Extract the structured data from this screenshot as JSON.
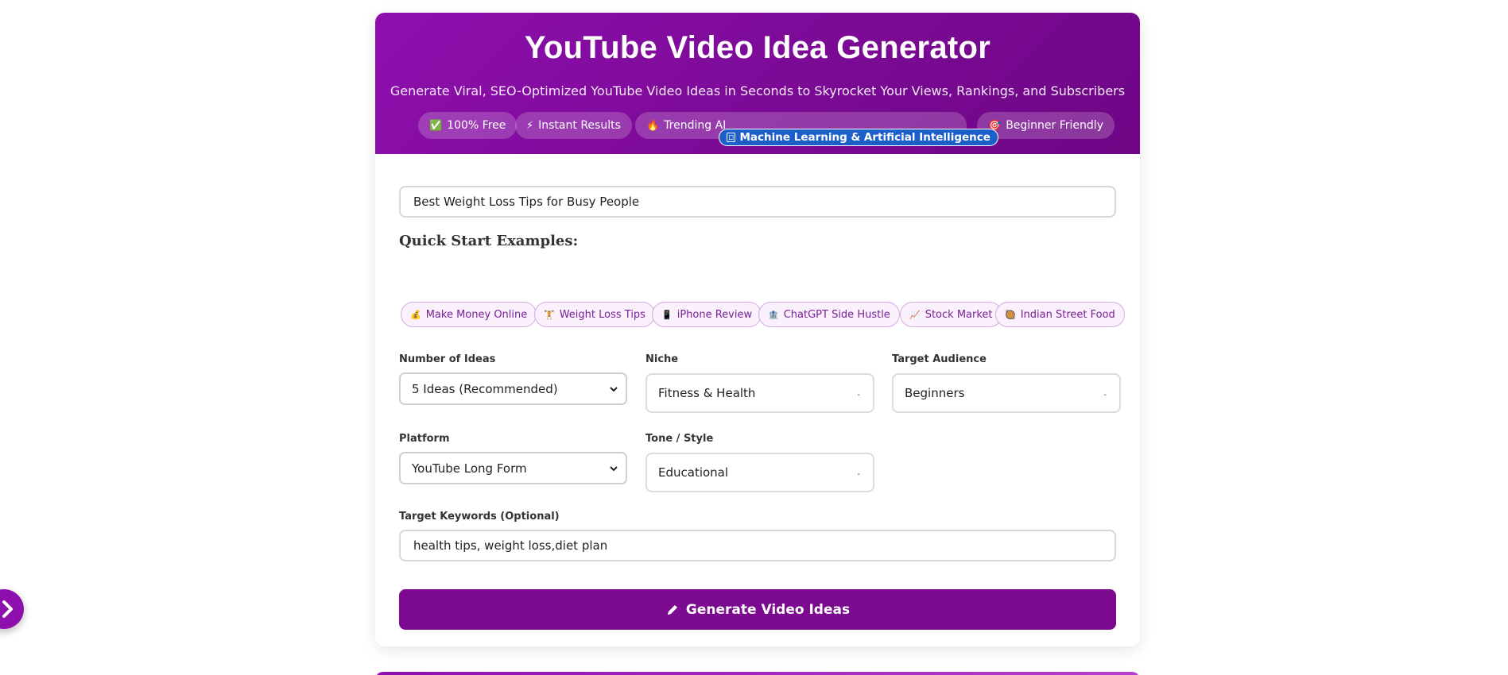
{
  "header": {
    "title": "YouTube Video Idea Generator",
    "subtitle": "Generate Viral, SEO-Optimized YouTube Video Ideas in Seconds to Skyrocket Your Views, Rankings, and Subscribers",
    "badges": [
      {
        "icon": "✅",
        "label": "100% Free"
      },
      {
        "icon": "⚡",
        "label": "Instant Results"
      },
      {
        "icon": "🔥",
        "label": "Trending AI"
      },
      {
        "icon": "🎯",
        "label": "Beginner Friendly"
      }
    ],
    "tooltip": "Machine Learning & Artificial Intelligence"
  },
  "form": {
    "topic_value": "Best Weight Loss Tips for Busy People",
    "quick_start_title": "Quick Start Examples:",
    "examples": [
      {
        "icon": "💰",
        "label": "Make Money Online"
      },
      {
        "icon": "🏋",
        "label": "Weight Loss Tips"
      },
      {
        "icon": "📱",
        "label": "iPhone Review"
      },
      {
        "icon": "🏦",
        "label": "ChatGPT Side Hustle"
      },
      {
        "icon": "📈",
        "label": "Stock Market"
      },
      {
        "icon": "🥘",
        "label": "Indian Street Food"
      }
    ],
    "num_ideas": {
      "label": "Number of Ideas",
      "value": "5 Ideas (Recommended)"
    },
    "niche": {
      "label": "Niche",
      "value": "Fitness & Health"
    },
    "audience": {
      "label": "Target Audience",
      "value": "Beginners"
    },
    "platform": {
      "label": "Platform",
      "value": "YouTube Long Form"
    },
    "tone": {
      "label": "Tone / Style",
      "value": "Educational"
    },
    "keywords": {
      "label": "Target Keywords (Optional)",
      "value": "health tips, weight loss,diet plan"
    },
    "generate_label": "Generate Video Ideas"
  },
  "colors": {
    "brand_purple": "#7c0a8f",
    "header_gradient_start": "#8e0fae",
    "tooltip_blue": "#1d5fc9"
  }
}
